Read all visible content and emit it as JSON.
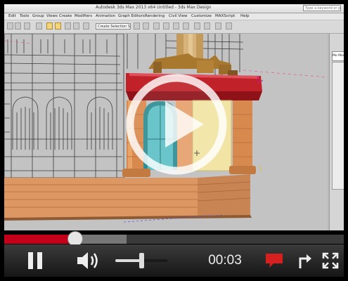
{
  "app": {
    "title": "Autodesk 3ds Max 2013 x64  Untitled - 3ds Max Design",
    "help_search": "Type a keyword or phrase",
    "menu": [
      "Edit",
      "Tools",
      "Group",
      "Views",
      "Create",
      "Modifiers",
      "Animation",
      "Graph Editors",
      "Rendering",
      "Civil View",
      "Customize",
      "MAXScript",
      "Help"
    ],
    "toolbar_selection_set": "Create Selection Se",
    "panel_tab": "Mo Mod"
  },
  "player": {
    "time": "00:03",
    "progress_played": 0.21,
    "progress_buffered": 0.36,
    "volume": 0.5,
    "colors": {
      "accent": "#c4001a",
      "chat": "#d62020"
    }
  },
  "icons": [
    "play-icon",
    "pause-icon",
    "volume-icon",
    "chat-icon",
    "share-icon",
    "fullscreen-icon"
  ]
}
